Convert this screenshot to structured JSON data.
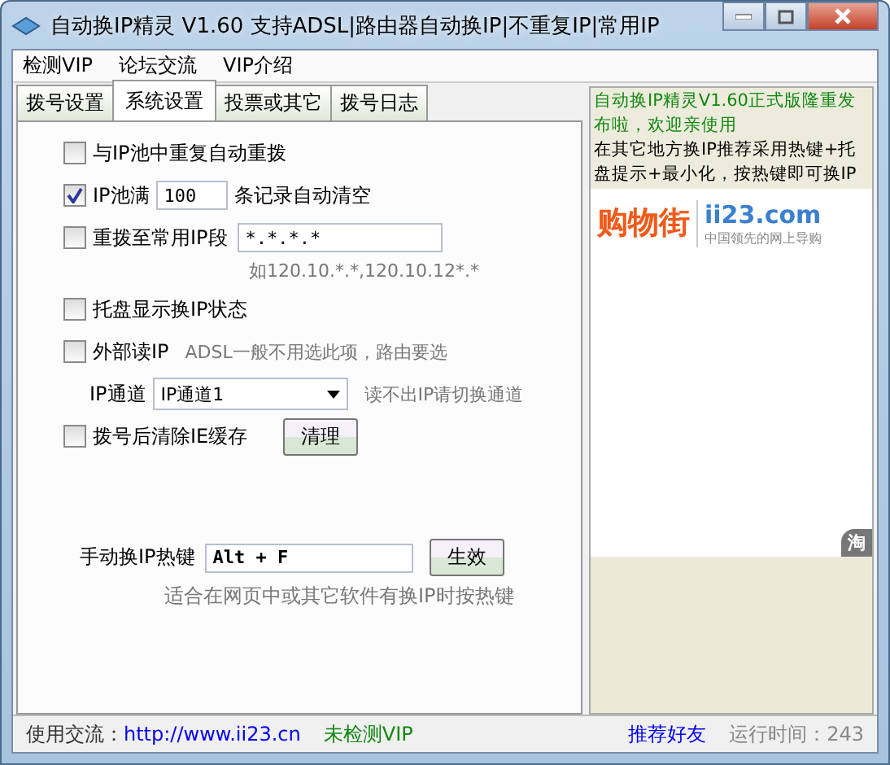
{
  "window": {
    "title": "自动换IP精灵 V1.60 支持ADSL|路由器自动换IP|不重复IP|常用IP"
  },
  "menu": [
    "检测VIP",
    "论坛交流",
    "VIP介绍"
  ],
  "tabs": [
    {
      "label": "拨号设置",
      "selected": false
    },
    {
      "label": "系统设置",
      "selected": true
    },
    {
      "label": "投票或其它",
      "selected": false
    },
    {
      "label": "拨号日志",
      "selected": false
    }
  ],
  "settings": [
    {
      "kind": "check",
      "label": "与IP池中重复自动重拨",
      "checked": false
    },
    {
      "kind": "count",
      "label": "IP池满",
      "checked": true,
      "value": "100",
      "suffix": "条记录自动清空"
    },
    {
      "kind": "range",
      "label": "重拨至常用IP段",
      "checked": false,
      "value": "*.*.*.*",
      "hint": "如120.10.*.*,120.10.12*.*"
    },
    {
      "kind": "check",
      "label": "托盘显示换IP状态",
      "checked": false
    },
    {
      "kind": "note",
      "label": "外部读IP",
      "checked": false,
      "note": "ADSL一般不用选此项，路由要选"
    },
    {
      "kind": "select",
      "label": "IP通道",
      "value": "IP通道1",
      "note": "读不出IP请切换通道"
    },
    {
      "kind": "action",
      "label": "拨号后清除IE缓存",
      "checked": false,
      "button": "清理"
    }
  ],
  "hotkey": {
    "label": "手动换IP热键",
    "value": "Alt + F",
    "button": "生效",
    "hint": "适合在网页中或其它软件有换IP时按热键"
  },
  "notice": {
    "headline": "自动换IP精灵V1.60正式版隆重发布啦，欢迎亲使用",
    "text": "在其它地方换IP推荐采用热键+托盘提示+最小化，按热键即可换IP"
  },
  "banner": {
    "brand": "购物街",
    "domain": "ii23.com",
    "slogan": "中国领先的网上导购",
    "tab": "淘"
  },
  "status_bar": [
    {
      "kind": "text",
      "text": "使用交流："
    },
    {
      "kind": "link",
      "text": "http://www.ii23.cn"
    },
    {
      "kind": "vip",
      "text": "未检测VIP"
    },
    {
      "kind": "promo",
      "text": "推荐好友"
    },
    {
      "kind": "runtime",
      "text": "运行时间：243"
    }
  ]
}
